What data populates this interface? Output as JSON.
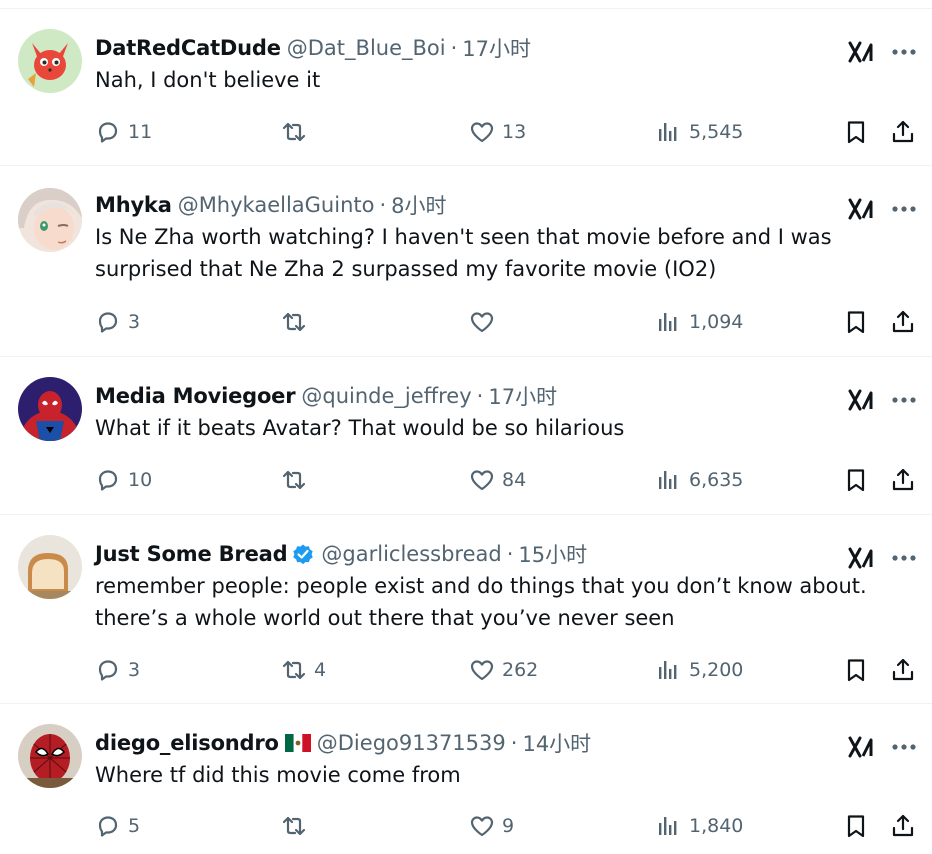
{
  "tweets": [
    {
      "name": "DatRedCatDude",
      "verified": false,
      "flag": "",
      "handle": "@Dat_Blue_Boi",
      "time": "17小时",
      "text": [
        "Nah, I don't believe it"
      ],
      "replies": "11",
      "reposts": "",
      "likes": "13",
      "views": "5,545",
      "avatar": "fox-avatar"
    },
    {
      "name": "Mhyka",
      "verified": false,
      "flag": "",
      "handle": "@MhykaellaGuinto",
      "time": "8小时",
      "text": [
        "Is Ne Zha worth watching? I haven't seen that movie before and I was",
        "surprised that Ne Zha 2 surpassed my favorite movie (IO2)"
      ],
      "replies": "3",
      "reposts": "",
      "likes": "",
      "views": "1,094",
      "avatar": "anime-girl-avatar"
    },
    {
      "name": "Media Moviegoer",
      "verified": false,
      "flag": "",
      "handle": "@quinde_jeffrey",
      "time": "17小时",
      "text": [
        "What if it beats Avatar? That would be so hilarious"
      ],
      "replies": "10",
      "reposts": "",
      "likes": "84",
      "views": "6,635",
      "avatar": "spiderman-avatar"
    },
    {
      "name": "Just Some Bread",
      "verified": true,
      "flag": "",
      "handle": "@garliclessbread",
      "time": "15小时",
      "text": [
        "remember people: people exist and do things that you don’t know about.",
        "there’s a whole world out there that you’ve never seen"
      ],
      "replies": "3",
      "reposts": "4",
      "likes": "262",
      "views": "5,200",
      "avatar": "bread-avatar"
    },
    {
      "name": "diego_elisondro",
      "verified": false,
      "flag": "mexico-flag",
      "handle": "@Diego91371539",
      "time": "14小时",
      "text": [
        "Where tf did this movie come from"
      ],
      "replies": "5",
      "reposts": "",
      "likes": "9",
      "views": "1,840",
      "avatar": "spiderman-mask-avatar"
    }
  ],
  "dot_separator": "·",
  "colors": {
    "text_primary": "#0f1419",
    "text_secondary": "#536471",
    "verified_blue": "#1d9bf0",
    "divider": "#eff3f4"
  },
  "icons": [
    "reply-icon",
    "repost-icon",
    "like-icon",
    "views-icon",
    "bookmark-icon",
    "share-icon",
    "grok-icon",
    "more-icon",
    "verified-badge-icon"
  ]
}
